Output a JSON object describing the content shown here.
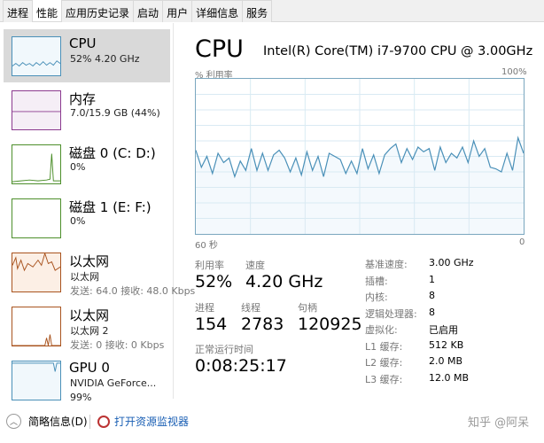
{
  "tabs": [
    "进程",
    "性能",
    "应用历史记录",
    "启动",
    "用户",
    "详细信息",
    "服务"
  ],
  "active_tab": 1,
  "sidebar": [
    {
      "title": "CPU",
      "line1": "52% 4.20 GHz",
      "color": "#4a90b8",
      "fill": "#f1f8fc"
    },
    {
      "title": "内存",
      "line1": "7.0/15.9 GB (44%)",
      "color": "#8b3a8f",
      "fill": "#f5eef6"
    },
    {
      "title": "磁盘 0 (C: D:)",
      "line1": "0%",
      "color": "#4d8f2b",
      "fill": "#ffffff"
    },
    {
      "title": "磁盘 1 (E: F:)",
      "line1": "0%",
      "color": "#4d8f2b",
      "fill": "#ffffff"
    },
    {
      "title": "以太网",
      "line1": "以太网",
      "line2": "发送: 64.0  接收: 48.0 Kbps",
      "color": "#a9541f",
      "fill": "#fcefe5"
    },
    {
      "title": "以太网",
      "line1": "以太网 2",
      "line2": "发送: 0  接收: 0 Kbps",
      "color": "#a9541f",
      "fill": "#ffffff"
    },
    {
      "title": "GPU 0",
      "line1": "NVIDIA GeForce...",
      "line2": "99%",
      "color": "#4a90b8",
      "fill": "#f1f8fc"
    }
  ],
  "main": {
    "title": "CPU",
    "model": "Intel(R) Core(TM) i7-9700 CPU @ 3.00GHz",
    "util_label": "% 利用率",
    "max_label": "100%",
    "time_label": "60 秒",
    "min_label": "0",
    "stats": {
      "utilization": {
        "label": "利用率",
        "value": "52%"
      },
      "speed": {
        "label": "速度",
        "value": "4.20 GHz"
      },
      "processes": {
        "label": "进程",
        "value": "154"
      },
      "threads": {
        "label": "线程",
        "value": "2783"
      },
      "handles": {
        "label": "句柄",
        "value": "120925"
      },
      "uptime": {
        "label": "正常运行时间",
        "value": "0:08:25:17"
      }
    },
    "specs": [
      {
        "k": "基准速度:",
        "v": "3.00 GHz"
      },
      {
        "k": "插槽:",
        "v": "1"
      },
      {
        "k": "内核:",
        "v": "8"
      },
      {
        "k": "逻辑处理器:",
        "v": "8"
      },
      {
        "k": "虚拟化:",
        "v": "已启用"
      },
      {
        "k": "L1 缓存:",
        "v": "512 KB"
      },
      {
        "k": "L2 缓存:",
        "v": "2.0 MB"
      },
      {
        "k": "L3 缓存:",
        "v": "12.0 MB"
      }
    ]
  },
  "chart_data": {
    "type": "area",
    "ylim": [
      0,
      100
    ],
    "xlim": [
      60,
      0
    ],
    "grid": true,
    "color": "#4a90b8",
    "values": [
      54,
      43,
      50,
      39,
      52,
      46,
      49,
      37,
      47,
      41,
      55,
      41,
      52,
      41,
      51,
      54,
      49,
      40,
      49,
      38,
      53,
      41,
      50,
      37,
      52,
      50,
      48,
      39,
      47,
      39,
      55,
      42,
      51,
      39,
      51,
      55,
      58,
      46,
      55,
      48,
      56,
      53,
      55,
      41,
      56,
      46,
      52,
      49,
      56,
      46,
      60,
      50,
      55,
      43,
      42,
      40,
      52,
      41,
      62,
      52
    ]
  },
  "footer": {
    "collapse": "简略信息(D)",
    "monitor": "打开资源监视器"
  },
  "watermark": "知乎 @阿呆"
}
